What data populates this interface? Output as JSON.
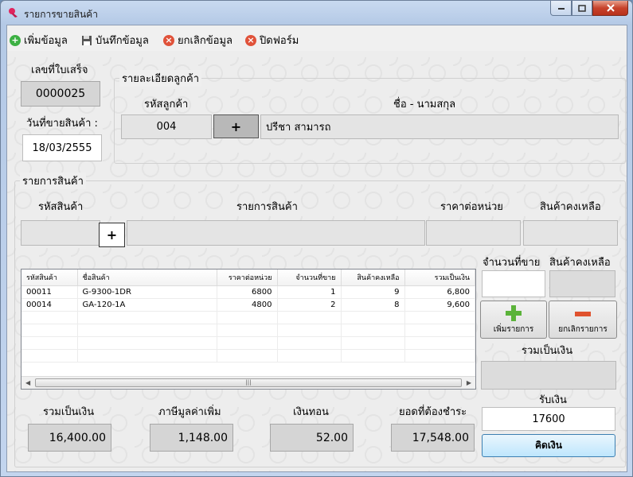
{
  "window": {
    "title": "รายการขายสินค้า"
  },
  "toolbar": {
    "add": "เพิ่มข้อมูล",
    "save": "บันทึกข้อมูล",
    "cancel": "ยกเลิกข้อมูล",
    "close": "ปิดฟอร์ม"
  },
  "receipt": {
    "label": "เลขที่ใบเสร็จ",
    "value": "0000025"
  },
  "sale_date": {
    "label": "วันที่ขายสินค้า :",
    "value": "18/03/2555"
  },
  "customer": {
    "group_label": "รายละเอียดลูกค้า",
    "code_label": "รหัสลูกค้า",
    "name_label": "ชื่อ - นามสกุล",
    "code": "004",
    "name": "ปรีชา สามารถ",
    "plus": "+"
  },
  "product": {
    "group_label": "รายการสินค้า",
    "code_label": "รหัสสินค้า",
    "item_label": "รายการสินค้า",
    "price_label": "ราคาต่อหน่วย",
    "stock_label": "สินค้าคงเหลือ",
    "plus": "+",
    "qty_label": "จำนวนที่ขาย",
    "stock_label2": "สินค้าคงเหลือ",
    "add_item": "เพิ่มรายการ",
    "cancel_item": "ยกเลิกรายการ",
    "line_total_label": "รวมเป็นเงิน"
  },
  "grid": {
    "columns": [
      "รหัสสินค้า",
      "ชื่อสินค้า",
      "ราคาต่อหน่วย",
      "จำนวนที่ขาย",
      "สินค้าคงเหลือ",
      "รวมเป็นเงิน"
    ],
    "rows": [
      [
        "00011",
        "G-9300-1DR",
        "6800",
        "1",
        "9",
        "6,800"
      ],
      [
        "00014",
        "GA-120-1A",
        "4800",
        "2",
        "8",
        "9,600"
      ]
    ]
  },
  "totals": {
    "sum_label": "รวมเป็นเงิน",
    "sum": "16,400.00",
    "vat_label": "ภาษีมูลค่าเพิ่ม",
    "vat": "1,148.00",
    "change_label": "เงินทอน",
    "change": "52.00",
    "due_label": "ยอดที่ต้องชำระ",
    "due": "17,548.00",
    "received_label": "รับเงิน",
    "received": "17600",
    "pay_button": "คิดเงิน"
  }
}
